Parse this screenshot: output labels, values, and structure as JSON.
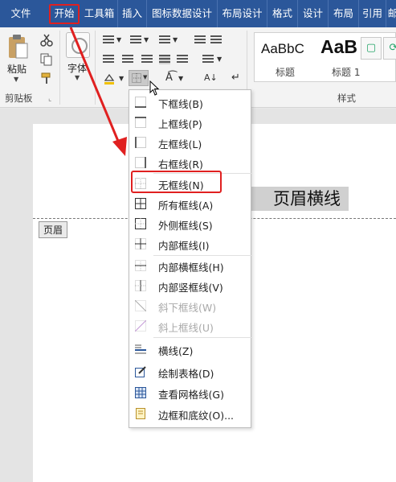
{
  "tabs": [
    {
      "label": "文件",
      "active": false
    },
    {
      "label": "开始",
      "active": true
    },
    {
      "label": "工具箱",
      "active": false
    },
    {
      "label": "插入",
      "active": false
    },
    {
      "label": "图标数据设计",
      "active": false
    },
    {
      "label": "布局设计",
      "active": false
    },
    {
      "label": "格式",
      "active": false
    },
    {
      "label": "设计",
      "active": false
    },
    {
      "label": "布局",
      "active": false
    },
    {
      "label": "引用",
      "active": false
    },
    {
      "label": "邮",
      "active": false
    }
  ],
  "ribbon": {
    "clipboard": {
      "paste_label": "粘贴",
      "group_label": "剪贴板"
    },
    "font": {
      "label": "字体"
    },
    "styles": {
      "sample1": "AaBbC",
      "sample2": "AaB",
      "name1": "标题",
      "name2": "标题 1",
      "group_label": "样式"
    }
  },
  "document": {
    "header_text": "页眉横线",
    "header_tag": "页眉"
  },
  "border_menu": {
    "items": [
      {
        "label": "下框线(B)",
        "icon": "bottom-border-icon",
        "disabled": false
      },
      {
        "label": "上框线(P)",
        "icon": "top-border-icon",
        "disabled": false
      },
      {
        "label": "左框线(L)",
        "icon": "left-border-icon",
        "disabled": false
      },
      {
        "label": "右框线(R)",
        "icon": "right-border-icon",
        "disabled": false
      },
      {
        "label": "无框线(N)",
        "icon": "no-border-icon",
        "disabled": false
      },
      {
        "label": "所有框线(A)",
        "icon": "all-borders-icon",
        "disabled": false
      },
      {
        "label": "外侧框线(S)",
        "icon": "outside-borders-icon",
        "disabled": false
      },
      {
        "label": "内部框线(I)",
        "icon": "inside-borders-icon",
        "disabled": false
      },
      {
        "label": "内部横框线(H)",
        "icon": "inside-horizontal-border-icon",
        "disabled": false
      },
      {
        "label": "内部竖框线(V)",
        "icon": "inside-vertical-border-icon",
        "disabled": false
      },
      {
        "label": "斜下框线(W)",
        "icon": "diagonal-down-border-icon",
        "disabled": true
      },
      {
        "label": "斜上框线(U)",
        "icon": "diagonal-up-border-icon",
        "disabled": true
      },
      {
        "label": "横线(Z)",
        "icon": "horizontal-line-icon",
        "disabled": false
      },
      {
        "label": "绘制表格(D)",
        "icon": "draw-table-icon",
        "disabled": false
      },
      {
        "label": "查看网格线(G)",
        "icon": "view-gridlines-icon",
        "disabled": false
      },
      {
        "label": "边框和底纹(O)...",
        "icon": "borders-shading-icon",
        "disabled": false
      }
    ],
    "highlighted": "无框线(N)"
  },
  "colors": {
    "tab_bar": "#2b579a",
    "highlight_red": "#e02020"
  }
}
